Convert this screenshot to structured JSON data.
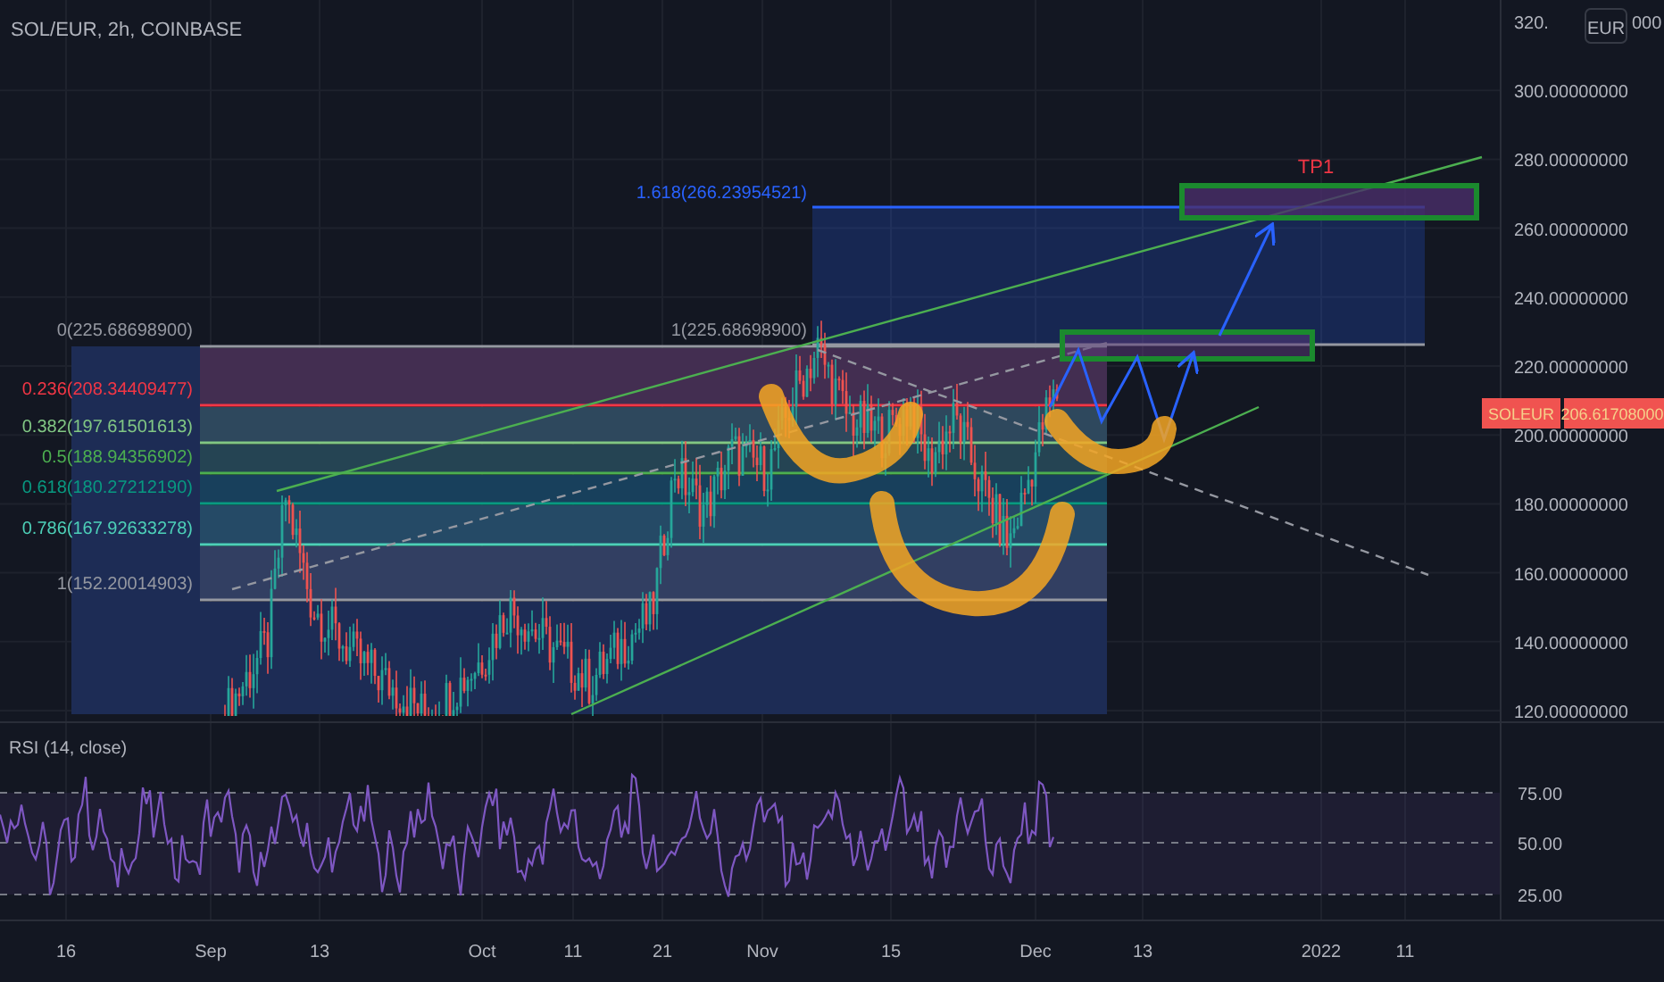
{
  "header": {
    "title": "SOL/EUR, 2h, COINBASE"
  },
  "price_axis": {
    "labels": [
      "300.00000000",
      "280.00000000",
      "260.00000000",
      "240.00000000",
      "220.00000000",
      "200.00000000",
      "180.00000000",
      "160.00000000",
      "140.00000000",
      "120.00000000"
    ],
    "top_label_head": "320.",
    "top_label_tail": "000",
    "currency_badge": "EUR"
  },
  "fib_retracement": {
    "levels": [
      {
        "label": "0(225.68698900)",
        "color": "#9598a1"
      },
      {
        "label": "0.236(208.34409477)",
        "color": "#f23645"
      },
      {
        "label": "0.382(197.61501613)",
        "color": "#81c784"
      },
      {
        "label": "0.5(188.94356902)",
        "color": "#4caf50"
      },
      {
        "label": "0.618(180.27212190)",
        "color": "#089981"
      },
      {
        "label": "0.786(167.92633278)",
        "color": "#4dd0b8"
      },
      {
        "label": "1(152.20014903)",
        "color": "#9598a1"
      }
    ]
  },
  "fib_extension": {
    "levels": [
      {
        "label": "1.618(266.23954521)",
        "color": "#2962ff"
      },
      {
        "label": "1(225.68698900)",
        "color": "#9598a1"
      }
    ]
  },
  "target_label": "TP1",
  "price_tag": {
    "symbol": "SOLEUR",
    "price": "206.61708000"
  },
  "rsi": {
    "title": "RSI (14, close)",
    "labels": [
      "75.00",
      "50.00",
      "25.00"
    ]
  },
  "time_axis": {
    "labels": [
      "16",
      "Sep",
      "13",
      "Oct",
      "11",
      "21",
      "Nov",
      "15",
      "Dec",
      "13",
      "2022",
      "11"
    ]
  }
}
